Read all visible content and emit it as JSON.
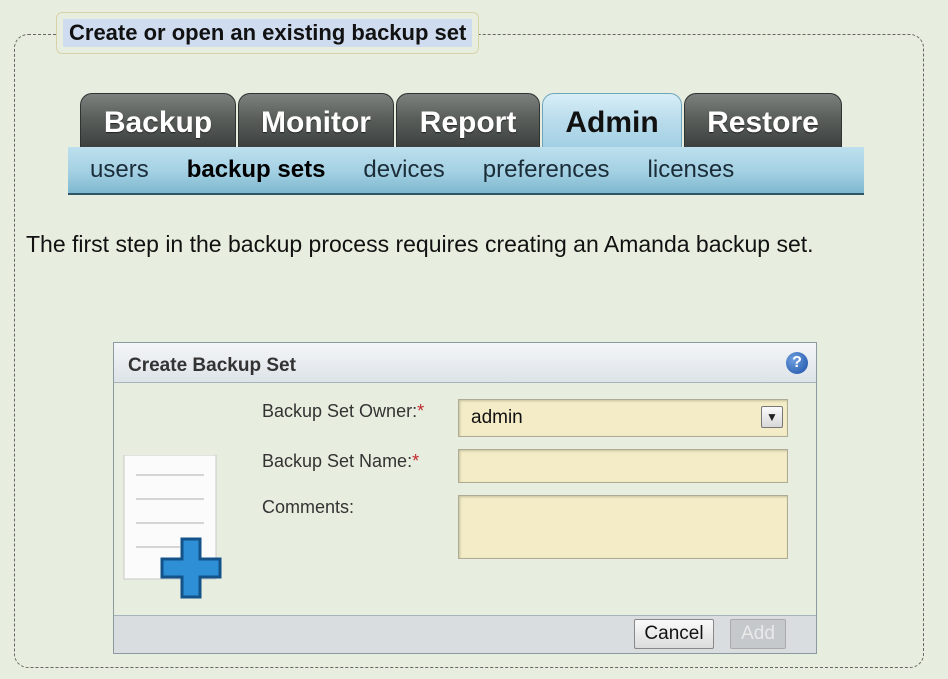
{
  "legend": {
    "title": "Create or open an existing backup set"
  },
  "tabs": [
    {
      "label": "Backup",
      "active": false
    },
    {
      "label": "Monitor",
      "active": false
    },
    {
      "label": "Report",
      "active": false
    },
    {
      "label": "Admin",
      "active": true
    },
    {
      "label": "Restore",
      "active": false
    }
  ],
  "subnav": [
    {
      "label": "users"
    },
    {
      "label": "backup sets",
      "active": true
    },
    {
      "label": "devices"
    },
    {
      "label": "preferences"
    },
    {
      "label": "licenses"
    }
  ],
  "intro": {
    "text": "The first step in the backup process requires creating an Amanda backup set."
  },
  "dialog": {
    "title": "Create Backup Set",
    "help_icon": "question-icon",
    "fields": {
      "owner_label": "Backup Set Owner:",
      "owner_value": "admin",
      "name_label": "Backup Set Name:",
      "name_value": "",
      "comments_label": "Comments:",
      "comments_value": "",
      "required_mark": "*"
    },
    "buttons": {
      "cancel": "Cancel",
      "add": "Add"
    }
  },
  "colors": {
    "accent": "#a3d0e3",
    "tab_dark": "#4a4f4c",
    "field_bg": "#f3ecc6",
    "required": "#c0282d"
  }
}
